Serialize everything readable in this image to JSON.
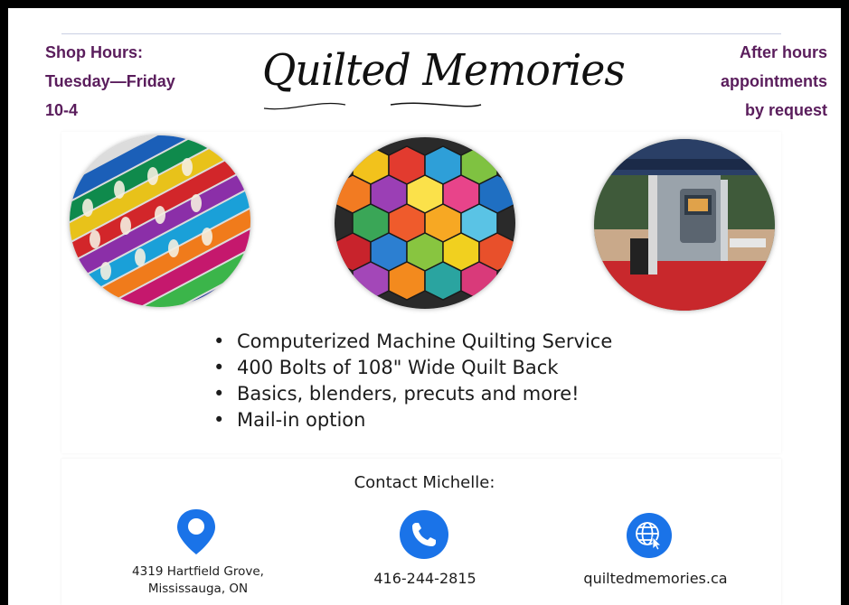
{
  "hours": {
    "lines": [
      "Shop Hours:",
      "Tuesday—Friday",
      "10-4"
    ]
  },
  "after_hours": {
    "lines": [
      "After hours",
      "appointments",
      "by request"
    ]
  },
  "logo": {
    "text": "Quilted Memories"
  },
  "images": [
    {
      "icon": "thread-spools-image"
    },
    {
      "icon": "hexagon-quilt-image"
    },
    {
      "icon": "quilting-machine-image"
    }
  ],
  "features": {
    "bullet": "•",
    "items": [
      "Computerized Machine Quilting Service",
      "400 Bolts of 108\" Wide Quilt Back",
      "Basics, blenders, precuts and more!",
      "Mail-in option"
    ]
  },
  "contact": {
    "heading": "Contact Michelle:",
    "address_lines": [
      "4319 Hartfield Grove,",
      "Mississauga, ON"
    ],
    "phone": "416-244-2815",
    "website": "quiltedmemories.ca"
  },
  "colors": {
    "accent_text": "#5a1d5c",
    "icon_blue": "#1a73e8"
  }
}
